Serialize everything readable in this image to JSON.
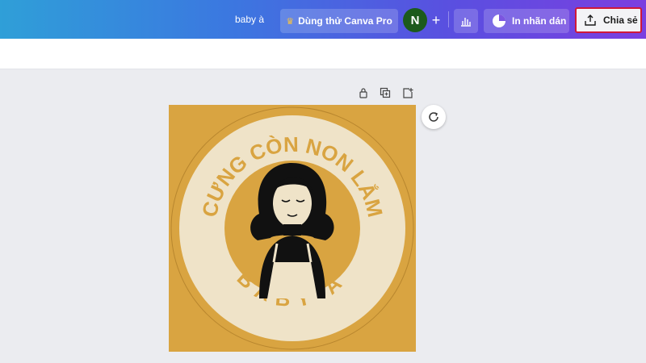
{
  "header": {
    "doc_title": "baby à",
    "pro_label": "Dùng thử Canva Pro",
    "avatar_initial": "N",
    "add_label": "+",
    "print_label": "In nhãn dán",
    "share_label": "Chia sẻ"
  },
  "design": {
    "top_text": "CƯNG CÒN NON LẮM",
    "bottom_text": "BABY À",
    "background_color": "#d9a441",
    "ring_color": "#efe3c8",
    "ink_color": "#111111"
  },
  "colors": {
    "share_highlight": "#d0183a",
    "avatar_bg": "#1c5a1c"
  },
  "icons": [
    "crown-icon",
    "add-person-icon",
    "insights-icon",
    "sticker-icon",
    "share-upload-icon",
    "lock-icon",
    "duplicate-icon",
    "add-page-icon",
    "refresh-icon"
  ]
}
